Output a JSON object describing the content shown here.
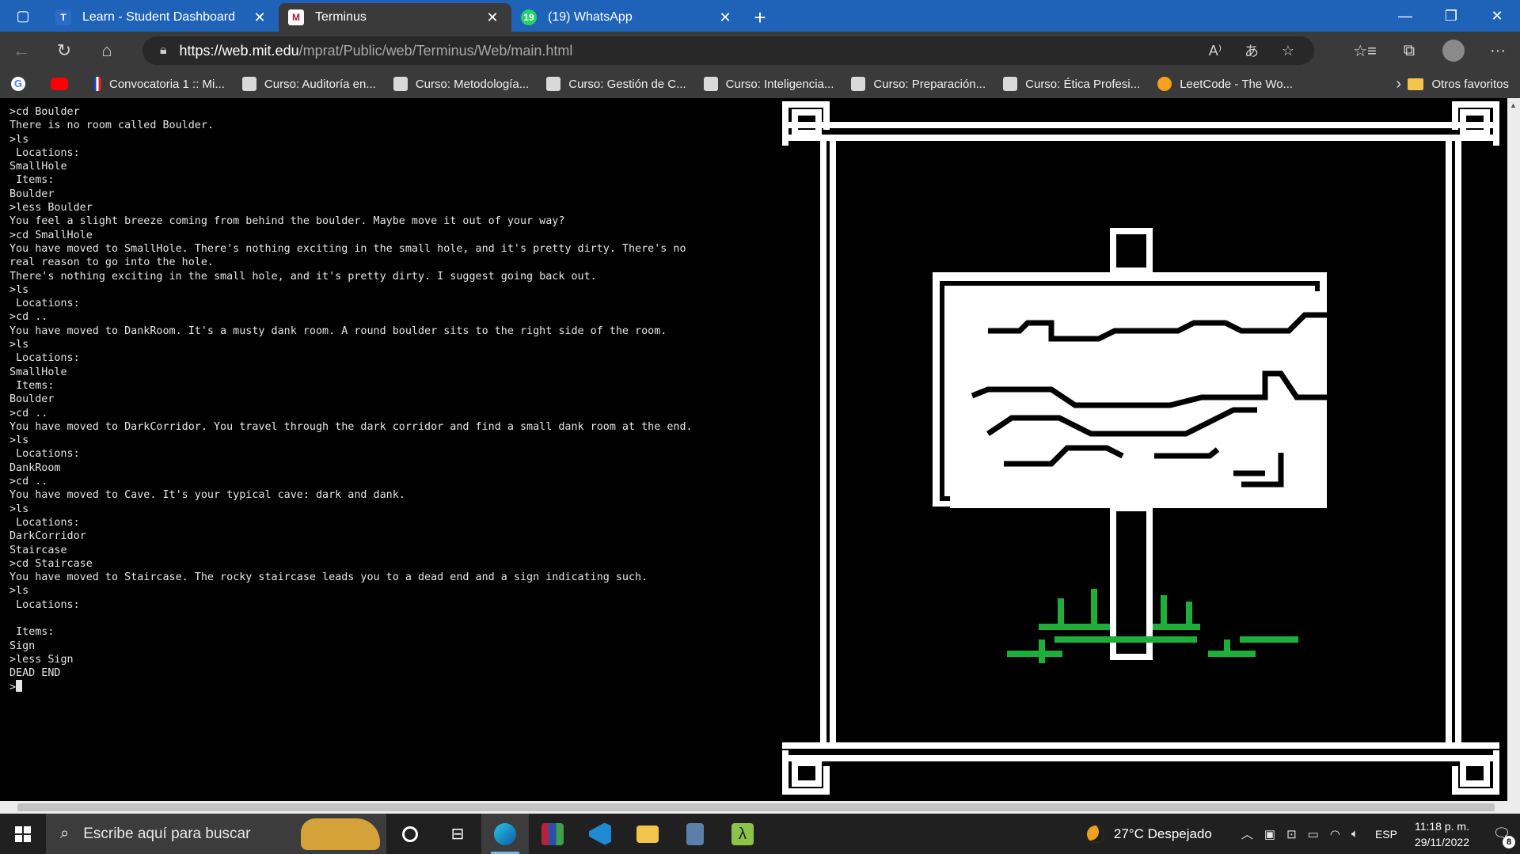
{
  "browser": {
    "tabs": [
      {
        "title": "Learn - Student Dashboard",
        "icon": "learn-icon",
        "color": "#2c6cc8",
        "active": false
      },
      {
        "title": "Terminus",
        "icon": "mit-icon",
        "color": "#a31f34",
        "active": true
      },
      {
        "title": "(19) WhatsApp",
        "icon": "whatsapp-icon",
        "color": "#25d366",
        "active": false
      }
    ],
    "url_host": "https://web.mit.edu",
    "url_path": "/mprat/Public/web/Terminus/Web/main.html",
    "bookmarks": [
      "Convocatoria 1 :: Mi...",
      "Curso: Auditoría en...",
      "Curso: Metodología...",
      "Curso: Gestión de C...",
      "Curso: Inteligencia...",
      "Curso: Preparación...",
      "Curso: Ética Profesi...",
      "LeetCode - The Wo..."
    ],
    "other_favorites": "Otros favoritos"
  },
  "terminal": {
    "lines": [
      ">cd Boulder",
      "There is no room called Boulder.",
      ">ls",
      " Locations:",
      "SmallHole",
      " Items:",
      "Boulder",
      ">less Boulder",
      "You feel a slight breeze coming from behind the boulder. Maybe move it out of your way?",
      ">cd SmallHole",
      "You have moved to SmallHole. There's nothing exciting in the small hole, and it's pretty dirty. There's no",
      "real reason to go into the hole.",
      "There's nothing exciting in the small hole, and it's pretty dirty. I suggest going back out.",
      ">ls",
      " Locations:",
      ">cd ..",
      "You have moved to DankRoom. It's a musty dank room. A round boulder sits to the right side of the room.",
      ">ls",
      " Locations:",
      "SmallHole",
      " Items:",
      "Boulder",
      ">cd ..",
      "You have moved to DarkCorridor. You travel through the dark corridor and find a small dank room at the end.",
      ">ls",
      " Locations:",
      "DankRoom",
      ">cd ..",
      "You have moved to Cave. It's your typical cave: dark and dank.",
      ">ls",
      " Locations:",
      "DarkCorridor",
      "Staircase",
      ">cd Staircase",
      "You have moved to Staircase. The rocky staircase leads you to a dead end and a sign indicating such.",
      ">ls",
      " Locations:",
      "",
      " Items:",
      "Sign",
      ">less Sign",
      "DEAD END"
    ],
    "prompt": ">"
  },
  "art": {
    "subject": "sign-post-pixel-art",
    "frame_color": "#ffffff",
    "grass_color": "#1fae3a"
  },
  "taskbar": {
    "search_placeholder": "Escribe aquí para buscar",
    "weather": "27°C  Despejado",
    "language": "ESP",
    "time": "11:18 p. m.",
    "date": "29/11/2022",
    "notifications": "8"
  }
}
